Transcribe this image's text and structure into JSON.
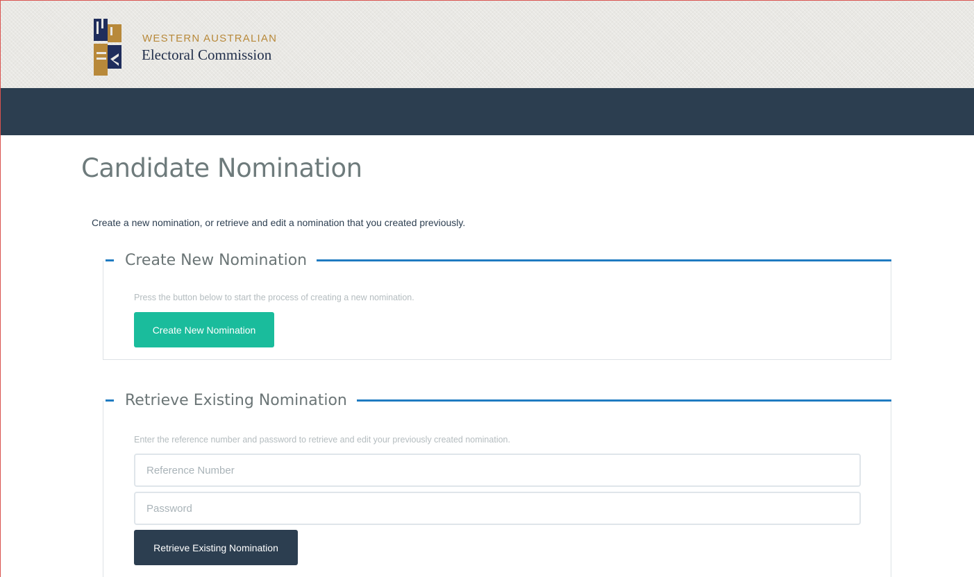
{
  "header": {
    "brand_line1": "WESTERN AUSTRALIAN",
    "brand_line2": "Electoral Commission",
    "logo_icon": "wa-electoral-commission-logo",
    "colors": {
      "navbar": "#2c3e50",
      "brand_gold": "#b8893a",
      "brand_navy": "#1f2d4a"
    }
  },
  "main": {
    "title": "Candidate Nomination",
    "intro": "Create a new nomination, or retrieve and edit a nomination that you created previously."
  },
  "create_panel": {
    "legend": "Create New Nomination",
    "toggle_icon": "collapse-minus-icon",
    "description": "Press the button below to start the process of creating a new nomination.",
    "button_label": "Create New Nomination",
    "button_color": "#1abc9c"
  },
  "retrieve_panel": {
    "legend": "Retrieve Existing Nomination",
    "toggle_icon": "collapse-minus-icon",
    "description": "Enter the reference number and password to retrieve and edit your previously created nomination.",
    "reference_placeholder": "Reference Number",
    "reference_value": "",
    "password_placeholder": "Password",
    "password_value": "",
    "button_label": "Retrieve Existing Nomination",
    "button_color": "#2c3e50"
  },
  "accent_color": "#1f7bc1"
}
